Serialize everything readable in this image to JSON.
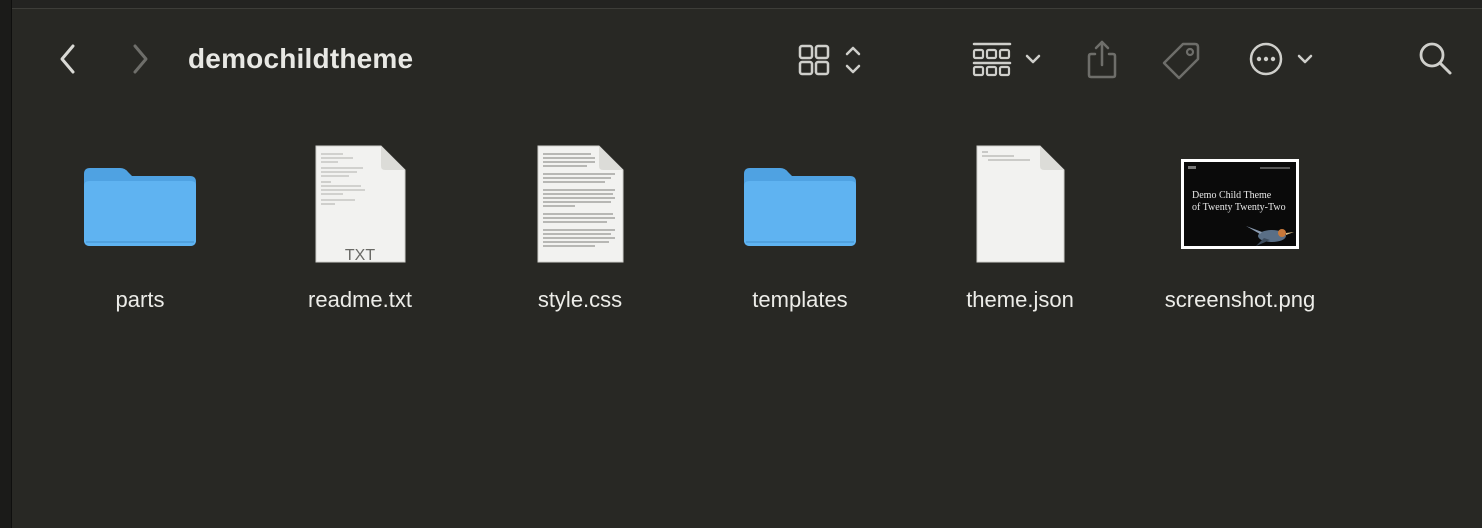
{
  "window": {
    "title": "demochildtheme"
  },
  "toolbar": {
    "back": "chevron-left-icon",
    "forward": "chevron-right-icon",
    "view_mode": "grid-view-icon",
    "group_by": "group-icon",
    "share": "share-icon",
    "tag": "tag-icon",
    "more": "ellipsis-circle-icon",
    "search": "search-icon"
  },
  "colors": {
    "background": "#282824",
    "folder": "#5fb3f1",
    "folder_tab": "#4fa2e2",
    "label_text": "#ecece8"
  },
  "files": [
    {
      "name": "parts",
      "kind": "folder"
    },
    {
      "name": "readme.txt",
      "kind": "text",
      "ext_label": "TXT"
    },
    {
      "name": "style.css",
      "kind": "text"
    },
    {
      "name": "templates",
      "kind": "folder"
    },
    {
      "name": "theme.json",
      "kind": "json"
    },
    {
      "name": "screenshot.png",
      "kind": "image",
      "thumbnail": {
        "line1": "Demo Child Theme",
        "line2": "of Twenty Twenty-Two"
      }
    }
  ]
}
